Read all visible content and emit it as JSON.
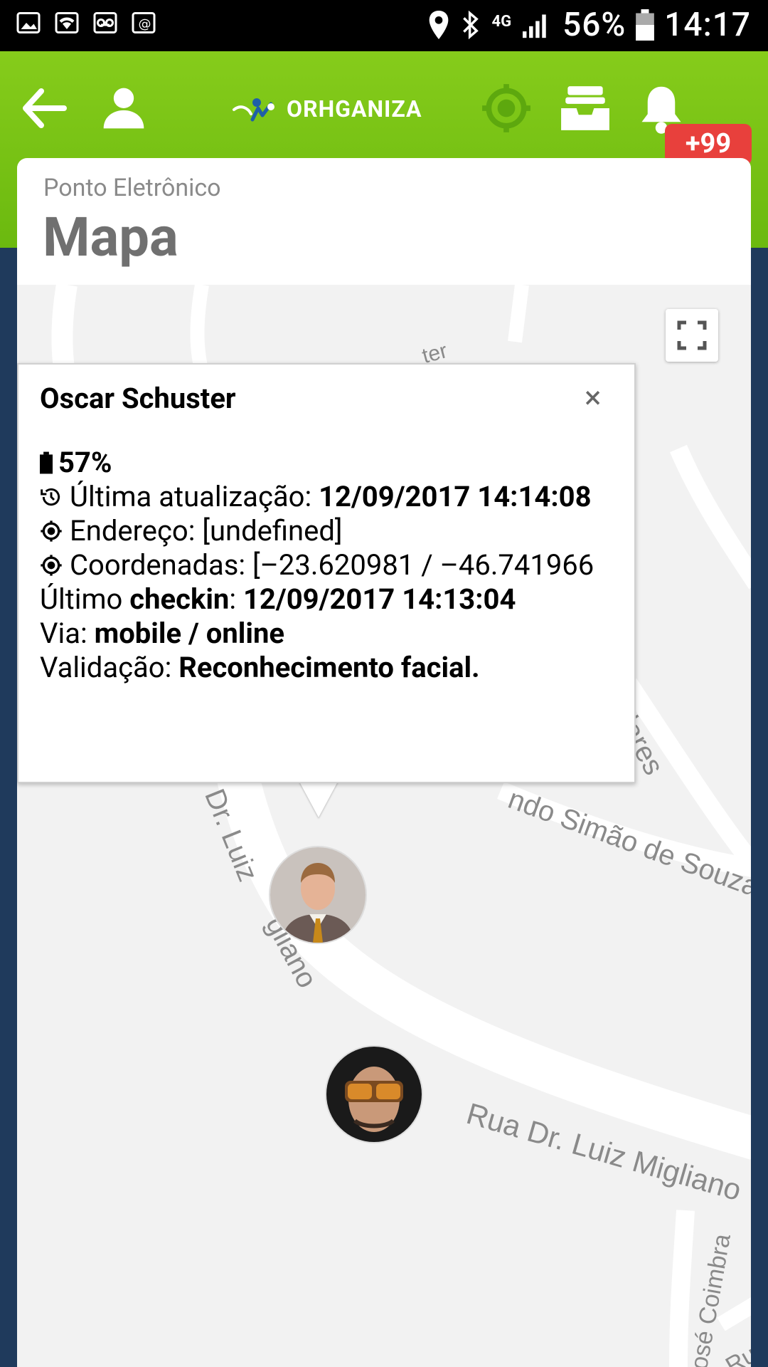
{
  "status_bar": {
    "battery": "56%",
    "time": "14:17",
    "network": "4G"
  },
  "header": {
    "brand": "ORHGANIZA",
    "notification_badge": "+99"
  },
  "page": {
    "subtitle": "Ponto Eletrônico",
    "title": "Mapa"
  },
  "popup": {
    "name": "Oscar Schuster",
    "battery": "57%",
    "last_update_label": "Última atualização: ",
    "last_update_value": "12/09/2017 14:14:08",
    "address_label": "Endereço: [undefined]",
    "coords_label": "Coordenadas: [–23.620981 / –46.741966",
    "checkin_prefix": "Último ",
    "checkin_word": "checkin",
    "checkin_sep": ": ",
    "checkin_value": "12/09/2017 14:13:04",
    "via_label": "Via: ",
    "via_value": "mobile / online",
    "validation_label": "Validação: ",
    "validation_value": "Reconhecimento facial.",
    "close": "×"
  },
  "map": {
    "streets": [
      "Rua Dr. Luiz Migliano",
      "Dr. Luiz",
      "gliano",
      "ndo Simão de Souza",
      "t Vilares",
      "osé Coimbra",
      "Rua",
      "ter"
    ]
  },
  "colors": {
    "header_green": "#7ac51a",
    "badge_red": "#e8403c",
    "background_navy": "#1f3a5c"
  }
}
